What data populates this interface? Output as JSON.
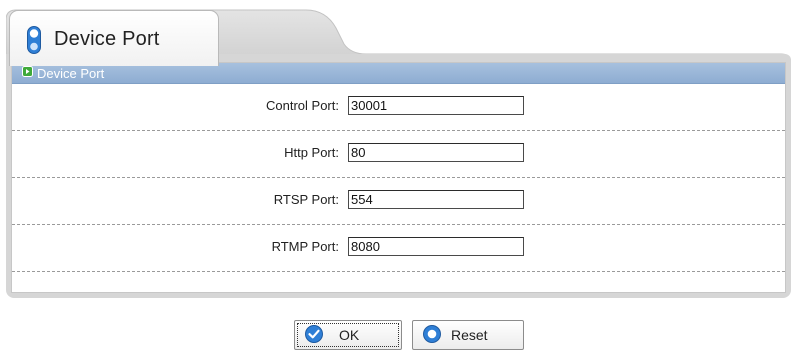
{
  "tab": {
    "label": "Device Port",
    "icon": "toggle-pill-icon"
  },
  "section": {
    "title": "Device Port",
    "icon": "green-arrow-icon"
  },
  "fields": [
    {
      "label": "Control Port:",
      "value": "30001"
    },
    {
      "label": "Http Port:",
      "value": "80"
    },
    {
      "label": "RTSP Port:",
      "value": "554"
    },
    {
      "label": "RTMP Port:",
      "value": "8080"
    }
  ],
  "buttons": {
    "ok": {
      "label": "OK",
      "icon": "check-circle-icon"
    },
    "reset": {
      "label": "Reset",
      "icon": "circle-ring-icon"
    }
  },
  "colors": {
    "header_blue": "#9bb7d9",
    "icon_blue": "#2f7fd6",
    "icon_green": "#3fa93a",
    "panel_gray": "#d6d6d6"
  }
}
